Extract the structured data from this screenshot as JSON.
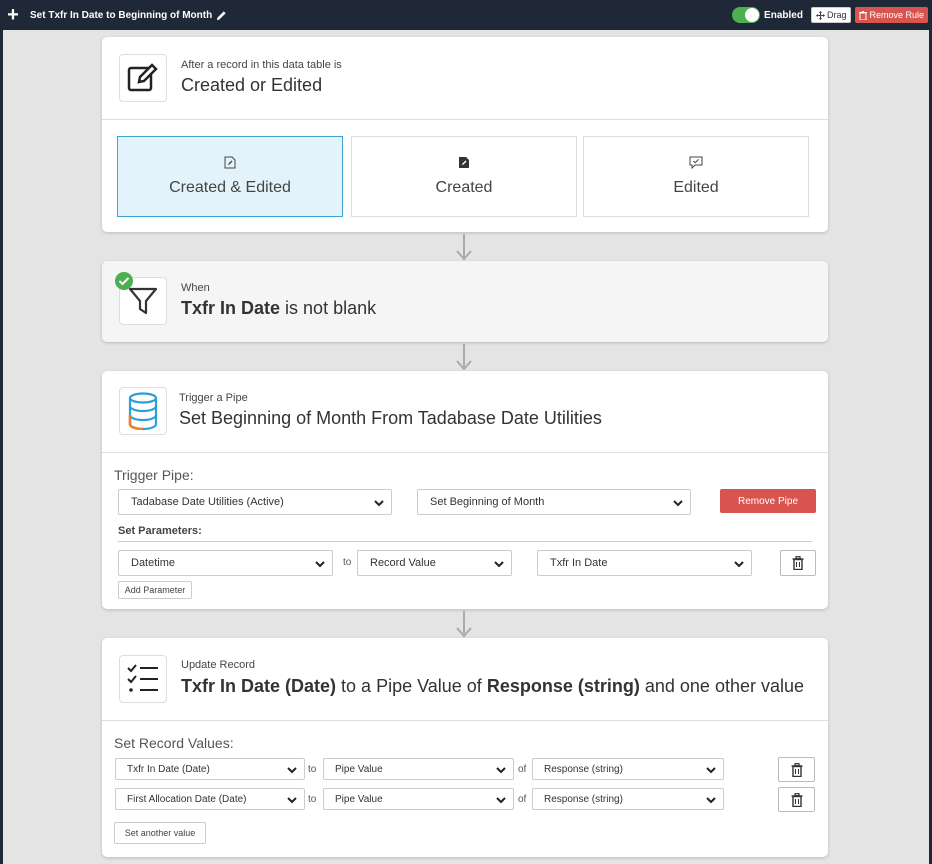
{
  "topbar": {
    "title": "Set Txfr In Date to Beginning of Month",
    "enabled_label": "Enabled",
    "drag_label": "Drag",
    "remove_rule_label": "Remove Rule"
  },
  "trigger_card": {
    "small_label": "After a record in this data table is",
    "big_label": "Created or Edited",
    "options": [
      {
        "label": "Created & Edited",
        "active": true
      },
      {
        "label": "Created",
        "active": false
      },
      {
        "label": "Edited",
        "active": false
      }
    ]
  },
  "condition_card": {
    "small_label": "When",
    "field": "Txfr In Date",
    "condition": "is not blank"
  },
  "pipe_card": {
    "small_label": "Trigger a Pipe",
    "big_label": "Set Beginning of Month From Tadabase Date Utilities",
    "trigger_pipe_label": "Trigger Pipe:",
    "pipe_select": "Tadabase Date Utilities (Active)",
    "function_select": "Set Beginning of Month",
    "remove_pipe_label": "Remove Pipe",
    "set_parameters_label": "Set Parameters:",
    "param_name": "Datetime",
    "to_label": "to",
    "param_source": "Record Value",
    "param_field": "Txfr In Date",
    "add_parameter_label": "Add Parameter"
  },
  "update_card": {
    "small_label": "Update Record",
    "field_bold": "Txfr In Date (Date)",
    "mid_text": "to a Pipe Value of",
    "value_bold": "Response (string)",
    "tail_text": "and one other value",
    "set_values_label": "Set Record Values:",
    "rows": [
      {
        "field": "Txfr In Date (Date)",
        "to": "to",
        "source": "Pipe Value",
        "of": "of",
        "value": "Response (string)"
      },
      {
        "field": "First Allocation Date (Date)",
        "to": "to",
        "source": "Pipe Value",
        "of": "of",
        "value": "Response (string)"
      }
    ],
    "set_another_label": "Set another value"
  },
  "colors": {
    "topbar_bg": "#1f2836",
    "accent_green": "#4caf50",
    "danger": "#d9534f",
    "active_option_bg": "#e3f3fb"
  }
}
